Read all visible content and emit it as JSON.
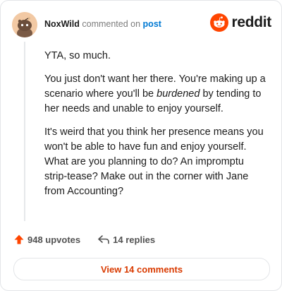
{
  "header": {
    "username": "NoxWild",
    "action_text": "commented on",
    "target_text": "post"
  },
  "brand": {
    "wordmark": "reddit",
    "accent_color": "#ff4500"
  },
  "comment": {
    "p1": "YTA, so much.",
    "p2_before": "You just don't want her there. You're making up a scenario where you'll be ",
    "p2_emphasis": "burdened",
    "p2_after": " by tending to her needs and unable to enjoy yourself.",
    "p3": "It's weird that you think her presence means you won't be able to have fun and enjoy yourself. What are you planning to do? An impromptu strip-tease? Make out in the corner with Jane from Accounting?"
  },
  "actions": {
    "upvotes_label": "948 upvotes",
    "replies_label": "14 replies",
    "upvote_icon": "upvote-arrow-icon",
    "reply_icon": "reply-arrow-icon"
  },
  "cta": {
    "label": "View 14 comments",
    "color": "#d93a00"
  }
}
